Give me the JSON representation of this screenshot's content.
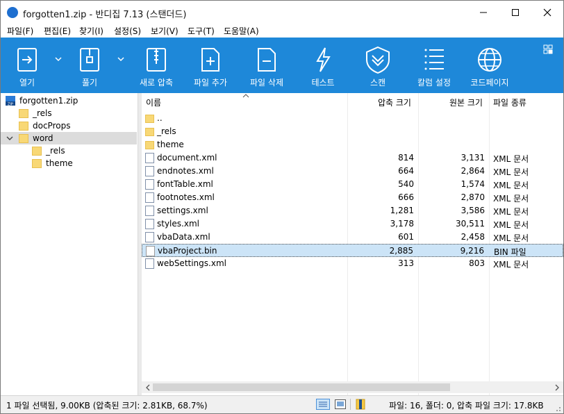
{
  "window": {
    "title": "forgotten1.zip - 반디집 7.13 (스탠더드)",
    "accent": "#1e88d9"
  },
  "menu": [
    "파일(F)",
    "편집(E)",
    "찾기(I)",
    "설정(S)",
    "보기(V)",
    "도구(T)",
    "도움말(A)"
  ],
  "toolbar": [
    {
      "label": "열기",
      "icon": "open-icon"
    },
    {
      "label": "풀기",
      "icon": "extract-icon"
    },
    {
      "label": "새로 압축",
      "icon": "new-archive-icon"
    },
    {
      "label": "파일 추가",
      "icon": "add-file-icon"
    },
    {
      "label": "파일 삭제",
      "icon": "delete-file-icon"
    },
    {
      "label": "테스트",
      "icon": "test-icon"
    },
    {
      "label": "스캔",
      "icon": "scan-icon"
    },
    {
      "label": "칼럼 설정",
      "icon": "columns-icon"
    },
    {
      "label": "코드페이지",
      "icon": "codepage-icon"
    }
  ],
  "tree": [
    {
      "label": "forgotten1.zip",
      "level": 0,
      "type": "zip"
    },
    {
      "label": "_rels",
      "level": 1,
      "type": "folder"
    },
    {
      "label": "docProps",
      "level": 1,
      "type": "folder"
    },
    {
      "label": "word",
      "level": 1,
      "type": "folder",
      "expanded": true,
      "selected": true
    },
    {
      "label": "_rels",
      "level": 2,
      "type": "folder"
    },
    {
      "label": "theme",
      "level": 2,
      "type": "folder"
    }
  ],
  "columns": {
    "name": "이름",
    "compressed": "압축 크기",
    "original": "원본 크기",
    "type": "파일 종류"
  },
  "files": [
    {
      "name": "..",
      "compressed": "",
      "original": "",
      "type": "",
      "kind": "folder"
    },
    {
      "name": "_rels",
      "compressed": "",
      "original": "",
      "type": "",
      "kind": "folder"
    },
    {
      "name": "theme",
      "compressed": "",
      "original": "",
      "type": "",
      "kind": "folder"
    },
    {
      "name": "document.xml",
      "compressed": "814",
      "original": "3,131",
      "type": "XML 문서",
      "kind": "xml"
    },
    {
      "name": "endnotes.xml",
      "compressed": "664",
      "original": "2,864",
      "type": "XML 문서",
      "kind": "xml"
    },
    {
      "name": "fontTable.xml",
      "compressed": "540",
      "original": "1,574",
      "type": "XML 문서",
      "kind": "xml"
    },
    {
      "name": "footnotes.xml",
      "compressed": "666",
      "original": "2,870",
      "type": "XML 문서",
      "kind": "xml"
    },
    {
      "name": "settings.xml",
      "compressed": "1,281",
      "original": "3,586",
      "type": "XML 문서",
      "kind": "xml"
    },
    {
      "name": "styles.xml",
      "compressed": "3,178",
      "original": "30,511",
      "type": "XML 문서",
      "kind": "xml"
    },
    {
      "name": "vbaData.xml",
      "compressed": "601",
      "original": "2,458",
      "type": "XML 문서",
      "kind": "xml"
    },
    {
      "name": "vbaProject.bin",
      "compressed": "2,885",
      "original": "9,216",
      "type": "BIN 파일",
      "kind": "bin",
      "selected": true
    },
    {
      "name": "webSettings.xml",
      "compressed": "313",
      "original": "803",
      "type": "XML 문서",
      "kind": "xml"
    }
  ],
  "status": {
    "left": "1 파일 선택됨, 9.00KB (압축된 크기: 2.81KB, 68.7%)",
    "right": "파일: 16, 폴더: 0, 압축 파일 크기: 17.8KB"
  }
}
